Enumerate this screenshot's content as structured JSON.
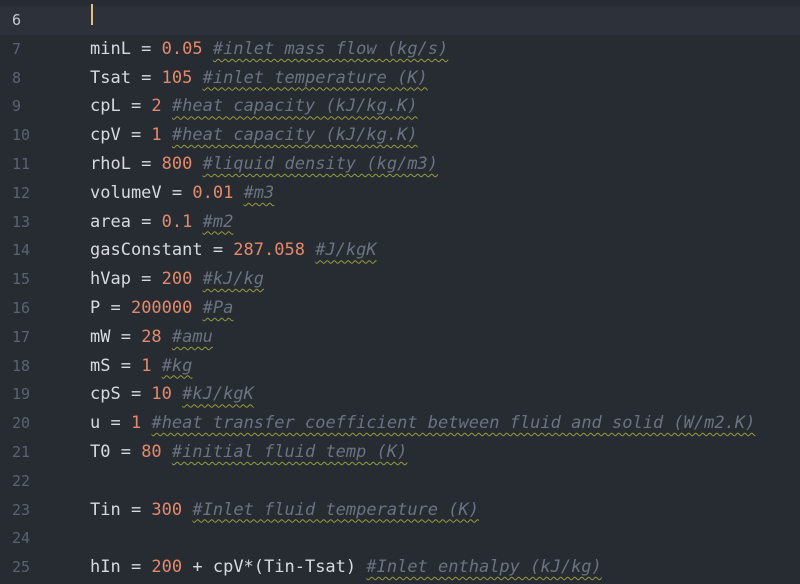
{
  "lines": [
    {
      "n": "6",
      "tokens": []
    },
    {
      "n": "7",
      "tokens": [
        {
          "t": "minL = ",
          "c": "op"
        },
        {
          "t": "0.05",
          "c": "num"
        },
        {
          "t": " ",
          "c": "op"
        },
        {
          "t": "#inlet mass flow (kg/s)",
          "c": "comment"
        }
      ]
    },
    {
      "n": "8",
      "tokens": [
        {
          "t": "Tsat = ",
          "c": "op"
        },
        {
          "t": "105",
          "c": "num"
        },
        {
          "t": " ",
          "c": "op"
        },
        {
          "t": "#inlet temperature (K)",
          "c": "comment"
        }
      ]
    },
    {
      "n": "9",
      "tokens": [
        {
          "t": "cpL = ",
          "c": "op"
        },
        {
          "t": "2",
          "c": "num"
        },
        {
          "t": " ",
          "c": "op"
        },
        {
          "t": "#heat capacity (kJ/kg.K)",
          "c": "comment"
        }
      ]
    },
    {
      "n": "10",
      "tokens": [
        {
          "t": "cpV = ",
          "c": "op"
        },
        {
          "t": "1",
          "c": "num"
        },
        {
          "t": " ",
          "c": "op"
        },
        {
          "t": "#heat capacity (kJ/kg.K)",
          "c": "comment"
        }
      ]
    },
    {
      "n": "11",
      "tokens": [
        {
          "t": "rhoL = ",
          "c": "op"
        },
        {
          "t": "800",
          "c": "num"
        },
        {
          "t": " ",
          "c": "op"
        },
        {
          "t": "#liquid density (kg/m3)",
          "c": "comment"
        }
      ]
    },
    {
      "n": "12",
      "tokens": [
        {
          "t": "volumeV = ",
          "c": "op"
        },
        {
          "t": "0.01",
          "c": "num"
        },
        {
          "t": " ",
          "c": "op"
        },
        {
          "t": "#m3",
          "c": "comment"
        }
      ]
    },
    {
      "n": "13",
      "tokens": [
        {
          "t": "area = ",
          "c": "op"
        },
        {
          "t": "0.1",
          "c": "num"
        },
        {
          "t": " ",
          "c": "op"
        },
        {
          "t": "#m2",
          "c": "comment"
        }
      ]
    },
    {
      "n": "14",
      "tokens": [
        {
          "t": "gasConstant = ",
          "c": "op"
        },
        {
          "t": "287.058",
          "c": "num"
        },
        {
          "t": " ",
          "c": "op"
        },
        {
          "t": "#J/kgK",
          "c": "comment"
        }
      ]
    },
    {
      "n": "15",
      "tokens": [
        {
          "t": "hVap = ",
          "c": "op"
        },
        {
          "t": "200",
          "c": "num"
        },
        {
          "t": " ",
          "c": "op"
        },
        {
          "t": "#kJ/kg",
          "c": "comment"
        }
      ]
    },
    {
      "n": "16",
      "tokens": [
        {
          "t": "P = ",
          "c": "op"
        },
        {
          "t": "200000",
          "c": "num"
        },
        {
          "t": " ",
          "c": "op"
        },
        {
          "t": "#Pa",
          "c": "comment"
        }
      ]
    },
    {
      "n": "17",
      "tokens": [
        {
          "t": "mW = ",
          "c": "op"
        },
        {
          "t": "28",
          "c": "num"
        },
        {
          "t": " ",
          "c": "op"
        },
        {
          "t": "#amu",
          "c": "comment"
        }
      ]
    },
    {
      "n": "18",
      "tokens": [
        {
          "t": "mS = ",
          "c": "op"
        },
        {
          "t": "1",
          "c": "num"
        },
        {
          "t": " ",
          "c": "op"
        },
        {
          "t": "#kg",
          "c": "comment"
        }
      ]
    },
    {
      "n": "19",
      "tokens": [
        {
          "t": "cpS = ",
          "c": "op"
        },
        {
          "t": "10",
          "c": "num"
        },
        {
          "t": " ",
          "c": "op"
        },
        {
          "t": "#kJ/kgK",
          "c": "comment"
        }
      ]
    },
    {
      "n": "20",
      "tokens": [
        {
          "t": "u = ",
          "c": "op"
        },
        {
          "t": "1",
          "c": "num"
        },
        {
          "t": " ",
          "c": "op"
        },
        {
          "t": "#heat transfer coefficient between fluid and solid (W/m2.K)",
          "c": "comment"
        }
      ]
    },
    {
      "n": "21",
      "tokens": [
        {
          "t": "T0 = ",
          "c": "op"
        },
        {
          "t": "80",
          "c": "num"
        },
        {
          "t": " ",
          "c": "op"
        },
        {
          "t": "#initial fluid temp (K)",
          "c": "comment"
        }
      ]
    },
    {
      "n": "22",
      "tokens": []
    },
    {
      "n": "23",
      "tokens": [
        {
          "t": "Tin = ",
          "c": "op"
        },
        {
          "t": "300",
          "c": "num"
        },
        {
          "t": " ",
          "c": "op"
        },
        {
          "t": "#Inlet fluid temperature (K)",
          "c": "comment"
        }
      ]
    },
    {
      "n": "24",
      "tokens": []
    },
    {
      "n": "25",
      "tokens": [
        {
          "t": "hIn = ",
          "c": "op"
        },
        {
          "t": "200",
          "c": "num"
        },
        {
          "t": " + cpV*(Tin-Tsat) ",
          "c": "op"
        },
        {
          "t": "#Inlet enthalpy (kJ/kg)",
          "c": "comment"
        }
      ]
    }
  ],
  "active_line": "6",
  "colors": {
    "background": "#272c33",
    "number": "#e5896a",
    "comment": "#6b7380",
    "cursor": "#e5c07b"
  }
}
